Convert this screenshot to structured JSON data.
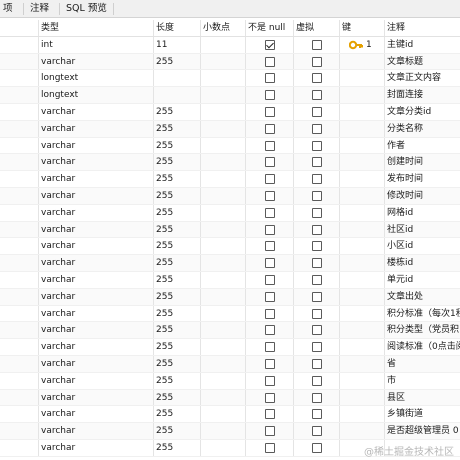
{
  "tabs": [
    {
      "label": "项",
      "selected": false
    },
    {
      "label": "注释",
      "selected": false
    },
    {
      "label": "SQL 预览",
      "selected": false
    }
  ],
  "columns": [
    "类型",
    "长度",
    "小数点",
    "不是 null",
    "虚拟",
    "键",
    "注释"
  ],
  "rows": [
    {
      "type": "int",
      "length": "11",
      "decimals": "",
      "not_null": true,
      "virtual": false,
      "key": "1",
      "comment": "主键id"
    },
    {
      "type": "varchar",
      "length": "255",
      "decimals": "",
      "not_null": false,
      "virtual": false,
      "key": "",
      "comment": "文章标题"
    },
    {
      "type": "longtext",
      "length": "",
      "decimals": "",
      "not_null": false,
      "virtual": false,
      "key": "",
      "comment": "文章正文内容"
    },
    {
      "type": "longtext",
      "length": "",
      "decimals": "",
      "not_null": false,
      "virtual": false,
      "key": "",
      "comment": "封面连接"
    },
    {
      "type": "varchar",
      "length": "255",
      "decimals": "",
      "not_null": false,
      "virtual": false,
      "key": "",
      "comment": "文章分类id"
    },
    {
      "type": "varchar",
      "length": "255",
      "decimals": "",
      "not_null": false,
      "virtual": false,
      "key": "",
      "comment": "分类名称"
    },
    {
      "type": "varchar",
      "length": "255",
      "decimals": "",
      "not_null": false,
      "virtual": false,
      "key": "",
      "comment": "作者"
    },
    {
      "type": "varchar",
      "length": "255",
      "decimals": "",
      "not_null": false,
      "virtual": false,
      "key": "",
      "comment": "创建时间"
    },
    {
      "type": "varchar",
      "length": "255",
      "decimals": "",
      "not_null": false,
      "virtual": false,
      "key": "",
      "comment": "发布时间"
    },
    {
      "type": "varchar",
      "length": "255",
      "decimals": "",
      "not_null": false,
      "virtual": false,
      "key": "",
      "comment": "修改时间"
    },
    {
      "type": "varchar",
      "length": "255",
      "decimals": "",
      "not_null": false,
      "virtual": false,
      "key": "",
      "comment": "网格id"
    },
    {
      "type": "varchar",
      "length": "255",
      "decimals": "",
      "not_null": false,
      "virtual": false,
      "key": "",
      "comment": "社区id"
    },
    {
      "type": "varchar",
      "length": "255",
      "decimals": "",
      "not_null": false,
      "virtual": false,
      "key": "",
      "comment": "小区id"
    },
    {
      "type": "varchar",
      "length": "255",
      "decimals": "",
      "not_null": false,
      "virtual": false,
      "key": "",
      "comment": "楼栋id"
    },
    {
      "type": "varchar",
      "length": "255",
      "decimals": "",
      "not_null": false,
      "virtual": false,
      "key": "",
      "comment": "单元id"
    },
    {
      "type": "varchar",
      "length": "255",
      "decimals": "",
      "not_null": false,
      "virtual": false,
      "key": "",
      "comment": "文章出处"
    },
    {
      "type": "varchar",
      "length": "255",
      "decimals": "",
      "not_null": false,
      "virtual": false,
      "key": "",
      "comment": "积分标准（每次1积"
    },
    {
      "type": "varchar",
      "length": "255",
      "decimals": "",
      "not_null": false,
      "virtual": false,
      "key": "",
      "comment": "积分类型（党员积"
    },
    {
      "type": "varchar",
      "length": "255",
      "decimals": "",
      "not_null": false,
      "virtual": false,
      "key": "",
      "comment": "阅读标准（0点击阅"
    },
    {
      "type": "varchar",
      "length": "255",
      "decimals": "",
      "not_null": false,
      "virtual": false,
      "key": "",
      "comment": "省"
    },
    {
      "type": "varchar",
      "length": "255",
      "decimals": "",
      "not_null": false,
      "virtual": false,
      "key": "",
      "comment": "市"
    },
    {
      "type": "varchar",
      "length": "255",
      "decimals": "",
      "not_null": false,
      "virtual": false,
      "key": "",
      "comment": "县区"
    },
    {
      "type": "varchar",
      "length": "255",
      "decimals": "",
      "not_null": false,
      "virtual": false,
      "key": "",
      "comment": "乡镇街道"
    },
    {
      "type": "varchar",
      "length": "255",
      "decimals": "",
      "not_null": false,
      "virtual": false,
      "key": "",
      "comment": "是否超级管理员 0"
    },
    {
      "type": "varchar",
      "length": "255",
      "decimals": "",
      "not_null": false,
      "virtual": false,
      "key": "",
      "comment": ""
    }
  ],
  "watermark": "@稀土掘金技术社区",
  "icons": {
    "primary_key": "key-icon"
  },
  "colors": {
    "key_icon": "#e5a100",
    "header_border": "#e2e2e2",
    "tab_background": "#f0f0f0"
  }
}
